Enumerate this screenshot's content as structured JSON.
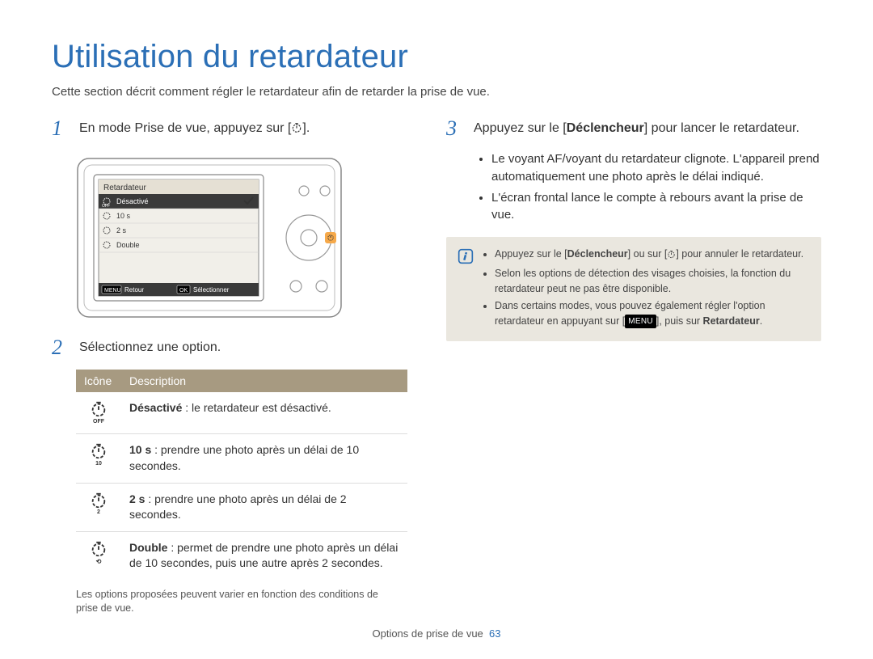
{
  "title": "Utilisation du retardateur",
  "intro": "Cette section décrit comment régler le retardateur afin de retarder la prise de vue.",
  "steps": {
    "s1": {
      "num": "1",
      "text_a": "En mode Prise de vue, appuyez sur [",
      "text_b": "]."
    },
    "s2": {
      "num": "2",
      "text": "Sélectionnez une option."
    },
    "s3": {
      "num": "3",
      "text_a": "Appuyez sur le [",
      "bold": "Déclencheur",
      "text_b": "] pour lancer le retardateur."
    }
  },
  "camera_menu": {
    "title": "Retardateur",
    "items": [
      "Désactivé",
      "10 s",
      "2 s",
      "Double"
    ],
    "back_label": "Retour",
    "select_label": "Sélectionner",
    "menu_badge": "MENU",
    "ok_badge": "OK"
  },
  "step3_bullets": [
    "Le voyant AF/voyant du retardateur clignote. L'appareil prend automatiquement une photo après le délai indiqué.",
    "L'écran frontal lance le compte à rebours avant la prise de vue."
  ],
  "info_notes": {
    "n1_a": "Appuyez sur le [",
    "n1_bold": "Déclencheur",
    "n1_b": "] ou sur [",
    "n1_c": "] pour annuler le retardateur.",
    "n2": "Selon les options de détection des visages choisies, la fonction du retardateur peut ne pas être disponible.",
    "n3_a": "Dans certains modes, vous pouvez également régler l'option retardateur en appuyant sur [",
    "n3_menu": "MENU",
    "n3_b": "], puis sur ",
    "n3_bold": "Retardateur",
    "n3_c": "."
  },
  "options_table": {
    "headers": {
      "icon": "Icône",
      "desc": "Description"
    },
    "rows": [
      {
        "icon": "timer-off",
        "label": "Désactivé",
        "desc": " : le retardateur est désactivé."
      },
      {
        "icon": "timer-10",
        "label": "10 s",
        "desc": " : prendre une photo après un délai de 10 secondes."
      },
      {
        "icon": "timer-2",
        "label": "2 s",
        "desc": " : prendre une photo après un délai de 2 secondes."
      },
      {
        "icon": "timer-double",
        "label": "Double",
        "desc": " : permet de prendre une photo après un délai de 10 secondes, puis une autre après 2 secondes."
      }
    ]
  },
  "options_note": "Les options proposées peuvent varier en fonction des conditions de prise de vue.",
  "footer": {
    "section": "Options de prise de vue",
    "page": "63"
  }
}
